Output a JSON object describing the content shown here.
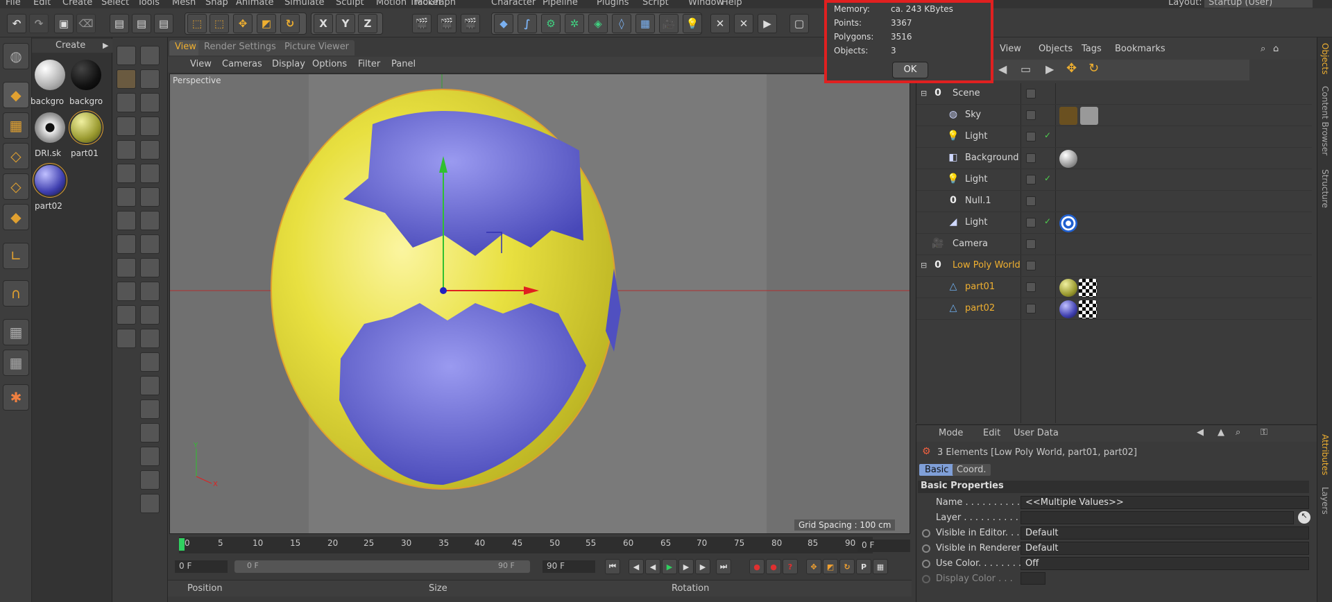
{
  "menubar": [
    "File",
    "Edit",
    "Create",
    "Select",
    "Tools",
    "Mesh",
    "Snap",
    "Animate",
    "Simulate",
    "Sculpt",
    "Motion Tracker",
    "MoGraph",
    "Character",
    "Pipeline",
    "Plugins",
    "Script",
    "Window",
    "Help"
  ],
  "layout": {
    "label": "Layout:",
    "value": "Startup (User)"
  },
  "materials": {
    "header": "Create",
    "items": [
      "backgro",
      "backgro",
      "DRI.sk",
      "part01",
      "part02"
    ]
  },
  "viewport": {
    "tabs": [
      "View",
      "Render Settings",
      "Picture Viewer"
    ],
    "menu": [
      "View",
      "Cameras",
      "Display",
      "Options",
      "Filter",
      "Panel"
    ],
    "label": "Perspective",
    "grid_spacing": "Grid Spacing : 100 cm"
  },
  "timeline": {
    "ticks": [
      "0",
      "5",
      "10",
      "15",
      "20",
      "25",
      "30",
      "35",
      "40",
      "45",
      "50",
      "55",
      "60",
      "65",
      "70",
      "75",
      "80",
      "85",
      "90"
    ],
    "frame_field": "0 F",
    "start_field": "0 F",
    "range_start": "0 F",
    "range_end": "90 F",
    "end_field": "90 F"
  },
  "coords": {
    "position": "Position",
    "size": "Size",
    "rotation": "Rotation"
  },
  "objects_menu": [
    "View",
    "Objects",
    "Tags",
    "Bookmarks"
  ],
  "objects": [
    {
      "name": "Scene",
      "indent": 0,
      "icon": "null-icon",
      "glyph": "0"
    },
    {
      "name": "Sky",
      "indent": 1,
      "icon": "sky-icon",
      "glyph": "◍"
    },
    {
      "name": "Light",
      "indent": 1,
      "icon": "light-icon",
      "glyph": "💡"
    },
    {
      "name": "Background",
      "indent": 1,
      "icon": "background-icon",
      "glyph": "◧"
    },
    {
      "name": "Light",
      "indent": 1,
      "icon": "light-icon",
      "glyph": "💡"
    },
    {
      "name": "Null.1",
      "indent": 1,
      "icon": "null-icon",
      "glyph": "0"
    },
    {
      "name": "Light",
      "indent": 1,
      "icon": "spot-light-icon",
      "glyph": "◢"
    },
    {
      "name": "Camera",
      "indent": 0,
      "icon": "camera-icon",
      "glyph": "🎥"
    },
    {
      "name": "Low Poly World",
      "indent": 0,
      "icon": "null-icon",
      "glyph": "0",
      "selected": true
    },
    {
      "name": "part01",
      "indent": 1,
      "icon": "polygon-icon",
      "glyph": "△",
      "selected": true
    },
    {
      "name": "part02",
      "indent": 1,
      "icon": "polygon-icon",
      "glyph": "△",
      "selected": true
    }
  ],
  "info_dialog": {
    "memory_label": "Memory:",
    "memory": "ca. 243 KBytes",
    "points_label": "Points:",
    "points": "3367",
    "polygons_label": "Polygons:",
    "polygons": "3516",
    "objects_label": "Objects:",
    "objects": "3",
    "ok": "OK"
  },
  "attributes": {
    "menu": [
      "Mode",
      "Edit",
      "User Data"
    ],
    "summary": "3 Elements [Low Poly World, part01, part02]",
    "tabs": [
      "Basic",
      "Coord."
    ],
    "section": "Basic Properties",
    "name_label": "Name . . . . . . . . . . . .",
    "name_value": "<<Multiple Values>>",
    "layer_label": "Layer . . . . . . . . . . . .",
    "layer_value": "",
    "vis_editor_label": "Visible in Editor. . .",
    "vis_editor_value": "Default",
    "vis_render_label": "Visible in Renderer",
    "vis_render_value": "Default",
    "use_color_label": "Use Color. . . . . . . .",
    "use_color_value": "Off",
    "display_color_label": "Display Color . . ."
  },
  "edge_tabs": [
    "Objects",
    "Content Browser",
    "Structure",
    "Attributes",
    "Layers"
  ],
  "colors": {
    "accent": "#f0b030",
    "highlight_red": "#e02020",
    "sphere_yellow": "#e8e040",
    "sphere_blue": "#6a6ad8"
  }
}
